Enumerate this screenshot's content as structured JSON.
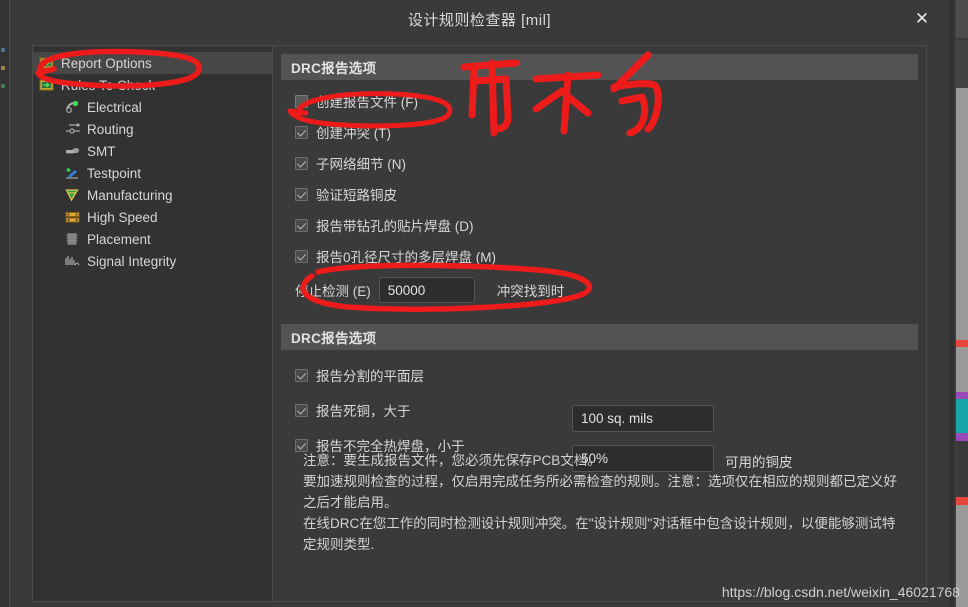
{
  "window": {
    "title": "设计规则检查器 [mil]",
    "close_label": "✕"
  },
  "sidebar": {
    "items": [
      {
        "label": "Report Options",
        "icon": "report-options-icon",
        "level": 0,
        "selected": true
      },
      {
        "label": "Rules To Check",
        "icon": "folder-rules-icon",
        "level": 0,
        "selected": false
      },
      {
        "label": "Electrical",
        "icon": "electrical-icon",
        "level": 1,
        "selected": false
      },
      {
        "label": "Routing",
        "icon": "routing-icon",
        "level": 1,
        "selected": false
      },
      {
        "label": "SMT",
        "icon": "smt-icon",
        "level": 1,
        "selected": false
      },
      {
        "label": "Testpoint",
        "icon": "testpoint-icon",
        "level": 1,
        "selected": false
      },
      {
        "label": "Manufacturing",
        "icon": "manufacturing-icon",
        "level": 1,
        "selected": false
      },
      {
        "label": "High Speed",
        "icon": "high-speed-icon",
        "level": 1,
        "selected": false
      },
      {
        "label": "Placement",
        "icon": "placement-icon",
        "level": 1,
        "selected": false
      },
      {
        "label": "Signal Integrity",
        "icon": "signal-integrity-icon",
        "level": 1,
        "selected": false
      }
    ]
  },
  "section1": {
    "header": "DRC报告选项",
    "options": [
      {
        "label": "创建报告文件 (F)",
        "checked": false
      },
      {
        "label": "创建冲突 (T)",
        "checked": true
      },
      {
        "label": "子网络细节 (N)",
        "checked": true
      },
      {
        "label": "验证短路铜皮",
        "checked": true
      },
      {
        "label": "报告带钻孔的贴片焊盘 (D)",
        "checked": true
      },
      {
        "label": "报告0孔径尺寸的多层焊盘 (M)",
        "checked": true
      }
    ],
    "stop_label": "停止检测 (E)",
    "stop_value": "50000",
    "stop_after": "冲突找到时"
  },
  "section2": {
    "header": "DRC报告选项",
    "options": [
      {
        "label": "报告分割的平面层",
        "checked": true
      },
      {
        "label": "报告死铜，大于",
        "checked": true
      },
      {
        "label": "报告不完全热焊盘，小于",
        "checked": true
      }
    ],
    "dead_copper_value": "100 sq. mils",
    "thermal_value": "50%",
    "thermal_after": "可用的铜皮"
  },
  "note": {
    "line1": "注意：要生成报告文件，您必须先保存PCB文档。",
    "line2": "要加速规则检查的过程，仅启用完成任务所必需检查的规则。注意：选项仅在相应的规则都已定义好之后才能启用。",
    "line3": "在线DRC在您工作的同时检测设计规则冲突。在\"设计规则\"对话框中包含设计规则，以便能够测试特定规则类型."
  },
  "watermark": {
    "text": "https://blog.csdn.net/weixin_46021768"
  },
  "annotations": {
    "color": "#ee1b1b",
    "handwriting": "可不勾",
    "marks": [
      "ellipse-around-report-options",
      "ellipse-around-create-report-file",
      "ellipse-around-stop-detection",
      "handwritten-note-ke-bu-gou"
    ]
  },
  "colors": {
    "window_bg": "#3a3a3a",
    "panel_bg": "#323232",
    "section_header_bg": "#535353",
    "text": "#d8d8d8",
    "annotation_red": "#ee1b1b",
    "field_bg": "#2d2d2d"
  }
}
